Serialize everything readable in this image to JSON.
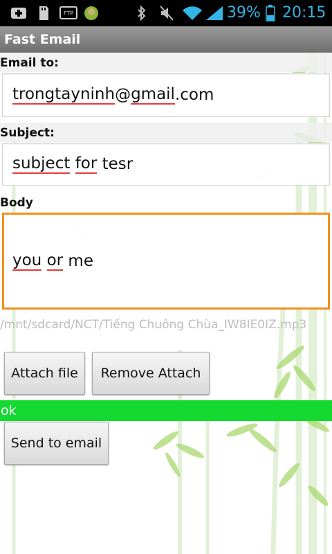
{
  "status_bar": {
    "battery_percent": "39%",
    "time": "20:15",
    "icons": [
      "add-icon",
      "sd-card-icon",
      "ftp-icon",
      "android-icon",
      "bluetooth-icon",
      "mute-icon",
      "wifi-icon",
      "signal-icon",
      "battery-icon"
    ],
    "accent_color": "#33b5e5"
  },
  "app": {
    "title": "Fast Email"
  },
  "form": {
    "email_label": "Email to:",
    "email_value": {
      "p1": "trongtayninh",
      "p2": "@",
      "p3": "gmail",
      "p4": ".com"
    },
    "subject_label": "Subject:",
    "subject_value": {
      "w1": "subject",
      "w2": "for",
      "w3": "tesr"
    },
    "body_label": "Body",
    "body_value": {
      "w1": "you",
      "w2": "or",
      "w3": "me"
    },
    "attachment_path": "/mnt/sdcard/NCT/Tiếng Chuông Chùa_IW8IE0IZ.mp3"
  },
  "buttons": {
    "attach_file": "Attach file",
    "remove_attach": "Remove Attach",
    "send_to_email": "Send to email"
  },
  "status_message": "ok",
  "colors": {
    "focus_border": "#f0901c",
    "ok_bar": "#13d930",
    "spellcheck_underline": "#e23b3b"
  }
}
